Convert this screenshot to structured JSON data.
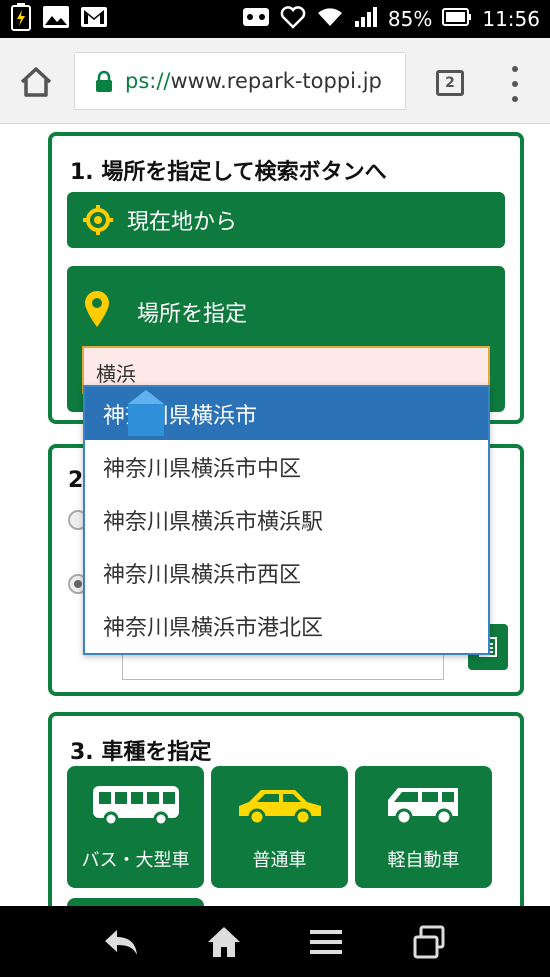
{
  "status_bar": {
    "battery_percent": "85%",
    "time": "11:56"
  },
  "browser": {
    "url_scheme": "ps://",
    "url_host": "www.repark-toppi.jp",
    "tab_count": "2"
  },
  "section1": {
    "title": "1.  場所を指定して検索ボタンへ",
    "current_location_label": "現在地から",
    "specify_place_label": "場所を指定",
    "search_value": "横浜"
  },
  "section2": {
    "title_fragment": "2"
  },
  "section3": {
    "title": "3.  車種を指定",
    "vehicles": [
      {
        "label": "バス・大型車"
      },
      {
        "label": "普通車"
      },
      {
        "label": "軽自動車"
      }
    ]
  },
  "autocomplete": {
    "items": [
      "神奈川県横浜市",
      "神奈川県横浜市中区",
      "神奈川県横浜市横浜駅",
      "神奈川県横浜市西区",
      "神奈川県横浜市港北区"
    ],
    "active_index": 0
  },
  "colors": {
    "brand_green": "#0e7a3d",
    "accent_yellow": "#ffcc00",
    "dropdown_active": "#2b72b6"
  }
}
